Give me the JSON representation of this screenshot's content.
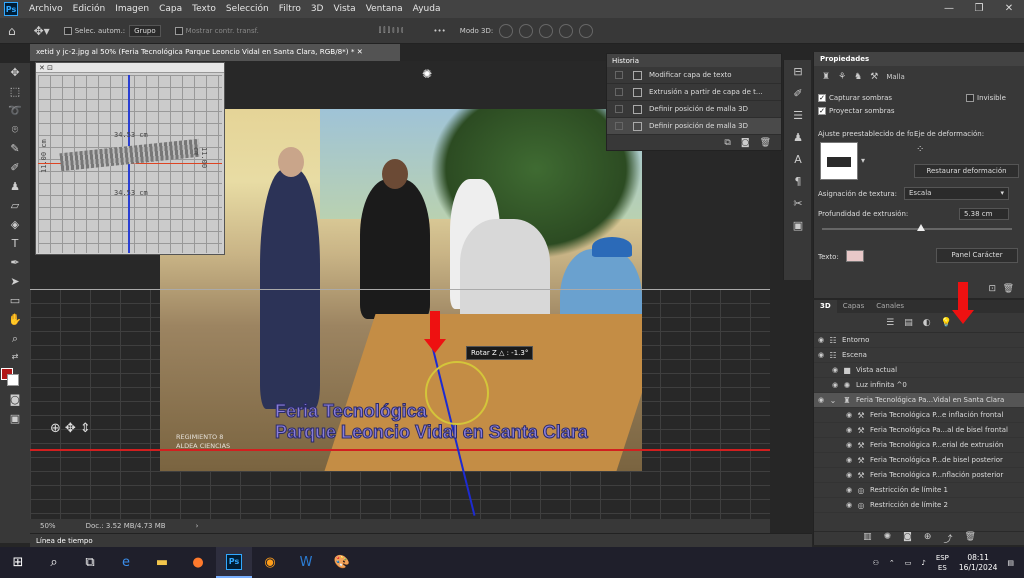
{
  "menubar": {
    "logo": "Ps",
    "items": [
      "Archivo",
      "Edición",
      "Imagen",
      "Capa",
      "Texto",
      "Selección",
      "Filtro",
      "3D",
      "Vista",
      "Ventana",
      "Ayuda"
    ],
    "window_controls": [
      "—",
      "❐",
      "✕"
    ]
  },
  "options_bar": {
    "auto_select_label": "Selec. autom.:",
    "auto_select_value": "Grupo",
    "show_transform_label": "Mostrar contr. transf.",
    "more": "•••",
    "mode_3d_label": "Modo 3D:"
  },
  "doc_tab": {
    "title": "xetid y jc-2.jpg al 50% (Feria Tecnológica Parque Leoncio Vidal en Santa Clara, RGB/8*) * ✕"
  },
  "mini_panel": {
    "controls": "✕  ⊡",
    "measure_top": "34.53 cm",
    "measure_bottom": "34.53 cm",
    "measure_left": "11.00 cm",
    "measure_right": "11.00 cm"
  },
  "canvas": {
    "text_line1": "Feria Tecnológica",
    "text_line2": "Parque Leoncio Vidal en Santa Clara",
    "tooltip": "Rotar Z △ : -1.3°",
    "watermark1": "REGIMIENTO 8",
    "watermark2": "ALDEA CIENCIAS"
  },
  "status": {
    "zoom": "50%",
    "doc": "Doc.: 3.52 MB/4.73 MB",
    "arrow": "›"
  },
  "timeline": {
    "label": "Línea de tiempo"
  },
  "history": {
    "title": "Historia",
    "items": [
      "Modificar capa de texto",
      "Extrusión a partir de capa de t...",
      "Definir posición de malla 3D",
      "Definir posición de malla 3D"
    ]
  },
  "properties": {
    "title": "Propiedades",
    "mesh_label": "Malla",
    "capture_shadows": "Capturar sombras",
    "invisible": "Invisible",
    "cast_shadows": "Proyectar sombras",
    "preset_label": "Ajuste preestablecido de forma:",
    "deform_axis_label": "Eje de deformación:",
    "restore_button": "Restaurar deformación",
    "texture_map_label": "Asignación de textura:",
    "texture_map_value": "Escala",
    "extrusion_depth_label": "Profundidad de extrusión:",
    "extrusion_depth_value": "5.38 cm",
    "text_label": "Texto:",
    "char_panel_button": "Panel Carácter",
    "text_color": "#e8c8c8",
    "slider_fraction": 0.52
  },
  "panel3d": {
    "tabs": [
      "3D",
      "Capas",
      "Canales"
    ],
    "layers": [
      {
        "label": "Entorno",
        "indent": 0
      },
      {
        "label": "Escena",
        "indent": 0
      },
      {
        "label": "Vista actual",
        "indent": 1
      },
      {
        "label": "Luz infinita ^0",
        "indent": 1
      },
      {
        "label": "Feria Tecnológica Pa...Vidal en Santa Clara",
        "indent": 1
      },
      {
        "label": "Feria Tecnológica P...e inflación frontal",
        "indent": 2
      },
      {
        "label": "Feria Tecnológica Pa...al de bisel frontal",
        "indent": 2
      },
      {
        "label": "Feria Tecnológica P...erial de extrusión",
        "indent": 2
      },
      {
        "label": "Feria Tecnológica P...de bisel posterior",
        "indent": 2
      },
      {
        "label": "Feria Tecnológica P...nflación posterior",
        "indent": 2
      },
      {
        "label": "Restricción de límite 1",
        "indent": 2
      },
      {
        "label": "Restricción de límite 2",
        "indent": 2
      }
    ]
  },
  "taskbar": {
    "lang1": "ESP",
    "lang2": "ES",
    "time": "08:11",
    "date": "16/1/2024"
  },
  "colors": {
    "accent_red": "#e11111",
    "axis_blue": "#1d2bd1",
    "axis_red": "#d21f1f",
    "fg_swatch": "#b01818",
    "bg_swatch": "#ffffff"
  }
}
